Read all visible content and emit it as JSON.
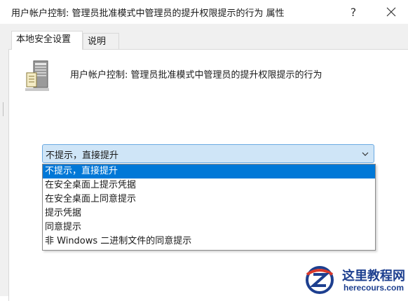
{
  "window": {
    "title": "用户帐户控制: 管理员批准模式中管理员的提升权限提示的行为 属性",
    "help_icon": "question-mark-icon",
    "close_icon": "close-icon"
  },
  "tabs": [
    {
      "label": "本地安全设置",
      "active": true
    },
    {
      "label": "说明",
      "active": false
    }
  ],
  "policy": {
    "icon": "server-policy-icon",
    "name": "用户帐户控制: 管理员批准模式中管理员的提升权限提示的行为"
  },
  "combo": {
    "selected_value": "不提示，直接提升",
    "arrow_icon": "chevron-down-icon",
    "options": [
      "不提示，直接提升",
      "在安全桌面上提示凭据",
      "在安全桌面上同意提示",
      "提示凭据",
      "同意提示",
      "非 Windows 二进制文件的同意提示"
    ],
    "highlighted_index": 0
  },
  "watermark": {
    "name": "这里教程网",
    "url": "herecours.com"
  },
  "colors": {
    "selection": "#0078d7",
    "combo_bg": "#cfe5f7",
    "combo_border": "#6aa9e2",
    "dialog_bg": "#f0f0f0",
    "watermark": "#1d3f8f"
  }
}
